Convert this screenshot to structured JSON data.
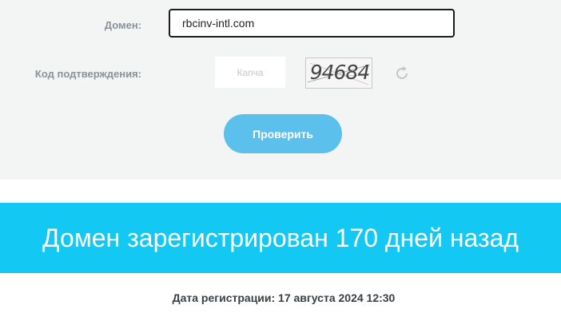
{
  "form": {
    "domain_label": "Домен:",
    "domain_value": "rbcinv-intl.com",
    "code_label": "Код подтверждения:",
    "captcha_placeholder": "Капча",
    "captcha_image_text": "94684",
    "refresh_icon": "refresh-icon",
    "submit_label": "Проверить"
  },
  "result": {
    "headline": "Домен зарегистрирован 170 дней назад",
    "registration_date": "Дата регистрации: 17 августа 2024 12:30"
  },
  "colors": {
    "form_background": "#f3f4f4",
    "button": "#5bc0eb",
    "banner": "#14c8f4"
  }
}
